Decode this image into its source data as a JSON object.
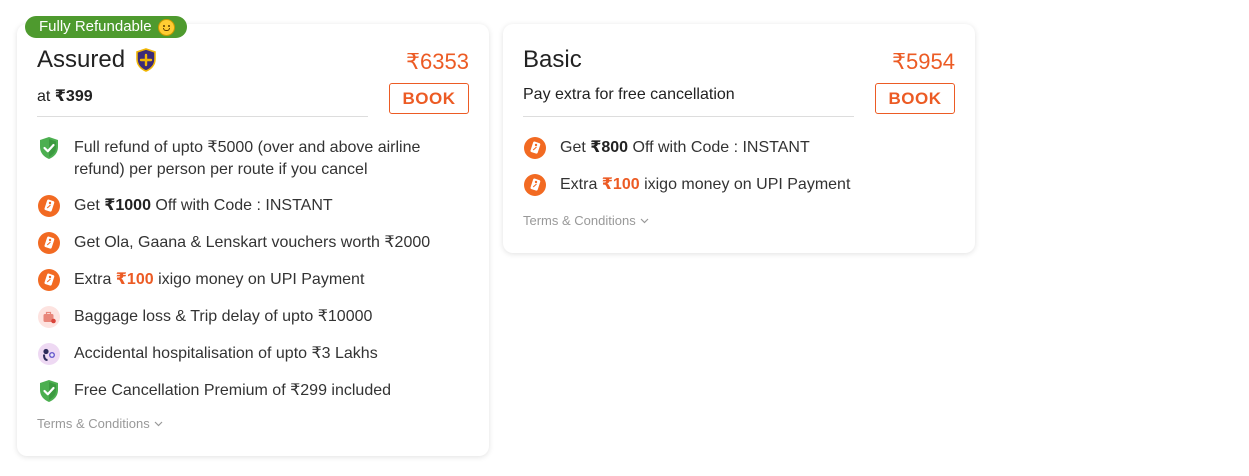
{
  "cards": [
    {
      "id": "assured",
      "ribbon": "Fully Refundable",
      "name": "Assured",
      "price": "₹6353",
      "sub_prefix": "at ",
      "sub_price": "₹399",
      "book_label": "BOOK",
      "features": [
        {
          "icon": "green-shield-check-icon",
          "pre": "Full refund of upto ₹5000 (over and above airline refund) per person per route if you cancel",
          "bold": "",
          "post": ""
        },
        {
          "icon": "offer-tag-icon",
          "pre": "Get ",
          "bold": "₹1000",
          "post": " Off with Code : INSTANT"
        },
        {
          "icon": "offer-tag-icon",
          "pre": "Get Ola, Gaana & Lenskart vouchers worth ₹2000",
          "bold": "",
          "post": ""
        },
        {
          "icon": "offer-tag-icon",
          "pre": "Extra ",
          "bold": "₹100",
          "post": " ixigo money on UPI Payment"
        },
        {
          "icon": "baggage-icon",
          "pre": "Baggage loss & Trip delay of upto ₹10000",
          "bold": "",
          "post": ""
        },
        {
          "icon": "hospital-icon",
          "pre": "Accidental hospitalisation of upto ₹3 Lakhs",
          "bold": "",
          "post": ""
        },
        {
          "icon": "green-shield-check-icon",
          "pre": "Free Cancellation Premium of ₹299 included",
          "bold": "",
          "post": ""
        }
      ],
      "terms": "Terms & Conditions"
    },
    {
      "id": "basic",
      "name": "Basic",
      "price": "₹5954",
      "sub_text": "Pay extra for free cancellation",
      "book_label": "BOOK",
      "features": [
        {
          "icon": "offer-tag-icon",
          "pre": "Get ",
          "bold": "₹800",
          "post": " Off with Code : INSTANT"
        },
        {
          "icon": "offer-tag-icon",
          "pre": "Extra ",
          "bold": "₹100",
          "post": " ixigo money on UPI Payment"
        }
      ],
      "terms": "Terms & Conditions"
    }
  ],
  "colors": {
    "accent": "#ec5b24",
    "ribbon": "#4e9a2e",
    "shield_green": "#4caf50",
    "badge_navy": "#3b2a78"
  }
}
